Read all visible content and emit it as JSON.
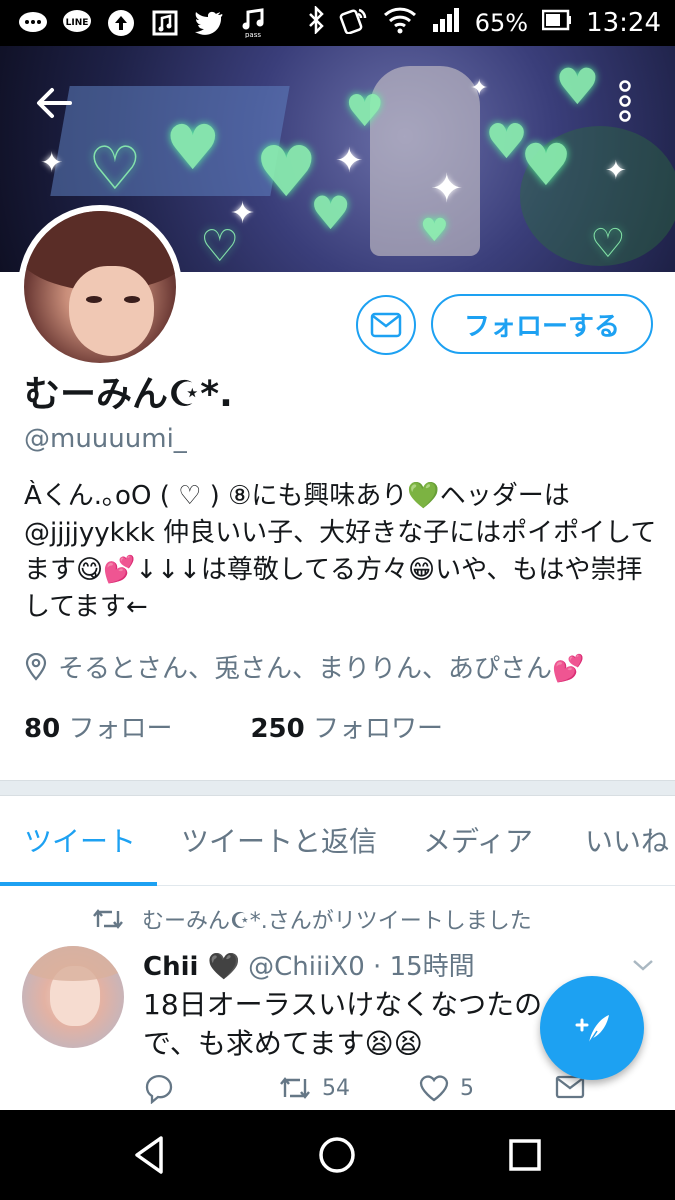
{
  "status_bar": {
    "battery": "65%",
    "time": "13:24",
    "left_icons": [
      "chat-bubble-icon",
      "line-app-icon",
      "upload-icon",
      "music-app-icon",
      "twitter-bird-icon",
      "pass-music-icon"
    ],
    "right_icons": [
      "bluetooth-icon",
      "nfc-icon",
      "wifi-icon",
      "signal-icon",
      "battery-icon"
    ]
  },
  "profile": {
    "display_name": "むーみん☪︎*.",
    "handle": "@muuuumi_",
    "bio": "Àくん.｡oO ( ♡ ) ⑧にも興味あり💚ヘッダーは@jjjjyykkk 仲良いい子、大好きな子にはポイポイしてます😋💕↓↓↓は尊敬してる方々😁いや、もはや崇拝してます←",
    "location": "そるとさん、兎さん、まりりん、あぴさん💕",
    "following_count": "80",
    "following_label": "フォロー",
    "followers_count": "250",
    "followers_label": "フォロワー",
    "follow_button": "フォローする"
  },
  "tabs": [
    "ツイート",
    "ツイートと返信",
    "メディア",
    "いいね"
  ],
  "active_tab": 0,
  "tweet": {
    "retweet_notice": "むーみん☪︎*.さんがリツイートしました",
    "author_name": "Chii 🖤",
    "author_handle": "@ChiiiX0",
    "time": "· 15時間",
    "text": "18日オーラスいけなくなつたので、も求めてます😫😫",
    "retweets": "54",
    "likes": "5"
  },
  "colors": {
    "accent": "#1da1f2",
    "muted": "#657786",
    "text": "#14171a"
  }
}
